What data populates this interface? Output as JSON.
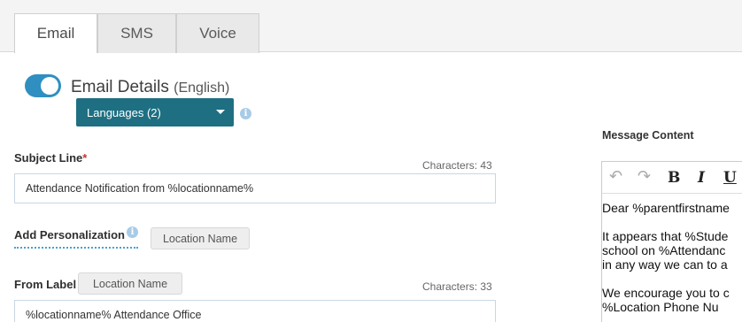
{
  "tabs": [
    {
      "label": "Email",
      "active": true
    },
    {
      "label": "SMS",
      "active": false
    },
    {
      "label": "Voice",
      "active": false
    }
  ],
  "email_details": {
    "title": "Email Details",
    "language_suffix": "(English)",
    "toggle_on": true,
    "languages_button": "Languages (2)"
  },
  "subject": {
    "label": "Subject Line",
    "required_mark": "*",
    "char_count": "Characters: 43",
    "value": "Attendance Notification from %locationname%"
  },
  "personalization": {
    "label": "Add Personalization",
    "pill": "Location Name"
  },
  "from_label": {
    "label": "From Label",
    "pill": "Location Name",
    "char_count": "Characters: 33",
    "value": "%locationname% Attendance Office"
  },
  "message": {
    "label": "Message Content",
    "toolbar": {
      "undo": "↶",
      "redo": "↷",
      "bold": "B",
      "italic": "I",
      "underline": "U"
    },
    "lines": [
      "Dear %parentfirstname",
      "It appears that %Stude",
      "school on %Attendanc",
      "in any way we can to a",
      "We encourage you to c",
      "%Location Phone Nu"
    ]
  },
  "colors": {
    "toggle": "#2f8fc1",
    "languages_button": "#1e6f82",
    "info_icon": "#a8cbe6",
    "required": "#c0392b"
  }
}
